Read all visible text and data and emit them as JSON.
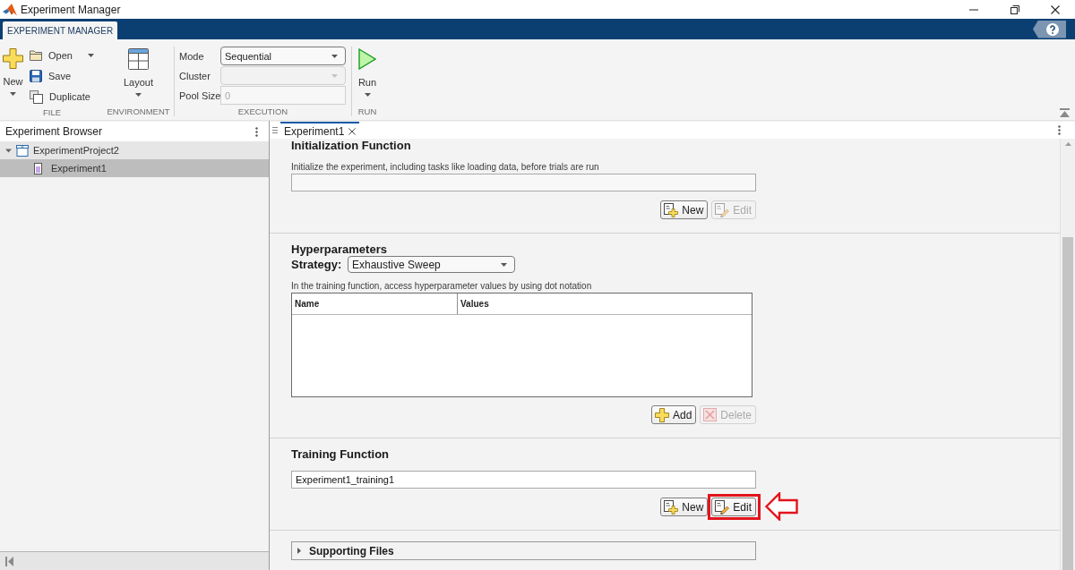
{
  "window": {
    "title": "Experiment Manager"
  },
  "toolstrip": {
    "tabs": [
      {
        "label": "EXPERIMENT MANAGER",
        "selected": true
      }
    ],
    "file_section": {
      "title": "FILE",
      "new_button": {
        "label": "New",
        "dropdown": true
      },
      "actions": [
        {
          "kind": "open",
          "label": "Open",
          "dropdown": true
        },
        {
          "kind": "save",
          "label": "Save",
          "dropdown": false
        },
        {
          "kind": "duplicate",
          "label": "Duplicate",
          "dropdown": false
        }
      ]
    },
    "environment_section": {
      "title": "ENVIRONMENT",
      "layout_button": {
        "label": "Layout",
        "dropdown": true
      }
    },
    "execution_section": {
      "title": "EXECUTION",
      "fields": [
        {
          "kind": "dropdown",
          "label": "Mode",
          "value": "Sequential",
          "disabled": false
        },
        {
          "kind": "dropdown",
          "label": "Cluster",
          "disabled": true
        },
        {
          "kind": "input",
          "label": "Pool Size",
          "value": "0",
          "disabled": true
        }
      ]
    },
    "run_section": {
      "title": "RUN",
      "run_button": {
        "label": "Run",
        "dropdown": true
      }
    }
  },
  "experiment_browser": {
    "title": "Experiment Browser",
    "tree": [
      {
        "kind": "project",
        "label": "ExperimentProject2",
        "expanded": true,
        "selected": false,
        "children": [
          {
            "kind": "experiment",
            "label": "Experiment1",
            "selected": true
          }
        ]
      }
    ]
  },
  "document": {
    "tabs": [
      {
        "label": "Experiment1",
        "selected": true
      }
    ],
    "sections": [
      {
        "kind": "function",
        "title": "Initialization Function",
        "description": "Initialize the experiment, including tasks like loading data, before trials are run",
        "buttons": [
          {
            "kind": "new",
            "label": "New",
            "disabled": false,
            "highlighted": false
          },
          {
            "kind": "edit",
            "label": "Edit",
            "disabled": true,
            "highlighted": false
          }
        ]
      },
      {
        "kind": "hyperparameters",
        "title": "Hyperparameters",
        "strategy": {
          "label": "Strategy:",
          "value": "Exhaustive Sweep"
        },
        "description": "In the training function, access hyperparameter values by using dot notation",
        "table": {
          "columns": [
            "Name",
            "Values"
          ]
        },
        "buttons": [
          {
            "kind": "add",
            "label": "Add",
            "disabled": false,
            "highlighted": false
          },
          {
            "kind": "delete",
            "label": "Delete",
            "disabled": true,
            "highlighted": false
          }
        ]
      },
      {
        "kind": "function",
        "title": "Training Function",
        "value": "Experiment1_training1",
        "buttons": [
          {
            "kind": "new",
            "label": "New",
            "disabled": false,
            "highlighted": false
          },
          {
            "kind": "edit",
            "label": "Edit",
            "disabled": false,
            "highlighted": true
          }
        ]
      },
      {
        "kind": "collapsible",
        "title": "Supporting Files",
        "expanded": false
      }
    ]
  }
}
